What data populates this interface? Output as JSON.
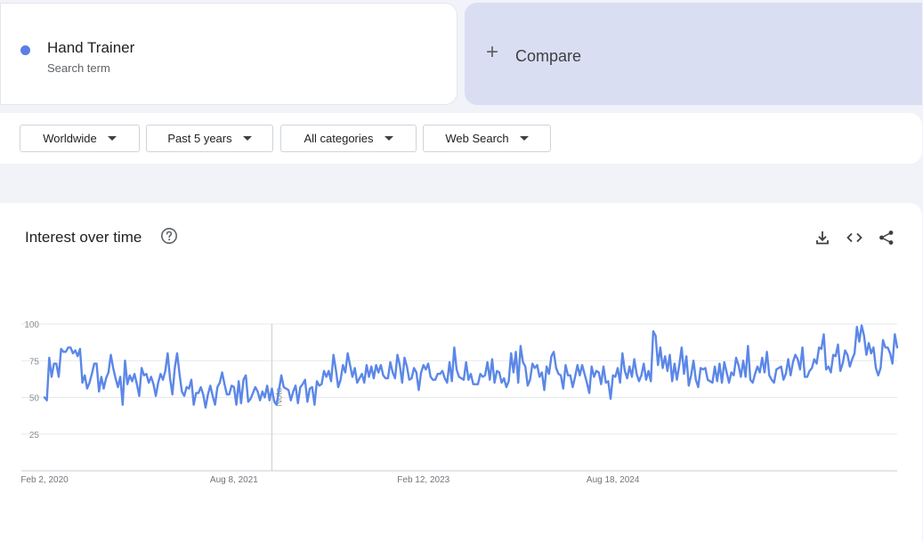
{
  "search_term": {
    "name": "Hand Trainer",
    "subtitle": "Search term",
    "color": "#5b7ee5"
  },
  "compare": {
    "label": "Compare"
  },
  "filters": [
    {
      "label": "Worldwide"
    },
    {
      "label": "Past 5 years"
    },
    {
      "label": "All categories"
    },
    {
      "label": "Web Search"
    }
  ],
  "panel": {
    "title": "Interest over time",
    "help_icon": "help-circle-icon",
    "actions": [
      "download-icon",
      "embed-code-icon",
      "share-icon"
    ]
  },
  "chart_data": {
    "type": "line",
    "ylim": [
      0,
      100
    ],
    "y_ticks": [
      100,
      75,
      50,
      25
    ],
    "x_tick_labels": [
      "Feb 2, 2020",
      "Aug 8, 2021",
      "Feb 12, 2023",
      "Aug 18, 2024"
    ],
    "x_tick_index": [
      0,
      80,
      160,
      240
    ],
    "note_label": "Note",
    "note_index": 96,
    "grid": true,
    "line_color": "#5b87e8",
    "series": [
      {
        "values": [
          50,
          48,
          77,
          64,
          73,
          73,
          64,
          83,
          81,
          81,
          84,
          84,
          80,
          82,
          78,
          83,
          60,
          65,
          56,
          60,
          66,
          73,
          73,
          54,
          64,
          56,
          63,
          67,
          79,
          70,
          63,
          57,
          64,
          45,
          75,
          59,
          65,
          61,
          66,
          59,
          51,
          70,
          65,
          66,
          60,
          64,
          59,
          51,
          60,
          66,
          62,
          68,
          80,
          63,
          52,
          70,
          80,
          66,
          54,
          51,
          57,
          56,
          62,
          45,
          53,
          53,
          57,
          52,
          43,
          52,
          58,
          51,
          45,
          57,
          60,
          67,
          59,
          52,
          52,
          58,
          57,
          45,
          61,
          46,
          62,
          65,
          47,
          49,
          53,
          57,
          54,
          48,
          54,
          50,
          58,
          48,
          56,
          47,
          45,
          55,
          65,
          57,
          56,
          55,
          48,
          54,
          58,
          46,
          57,
          59,
          62,
          47,
          56,
          57,
          45,
          61,
          58,
          59,
          68,
          64,
          68,
          61,
          79,
          69,
          57,
          62,
          72,
          67,
          80,
          72,
          64,
          70,
          60,
          63,
          66,
          60,
          72,
          64,
          71,
          63,
          72,
          67,
          72,
          65,
          63,
          63,
          74,
          67,
          63,
          79,
          72,
          60,
          77,
          71,
          62,
          63,
          70,
          67,
          55,
          67,
          72,
          69,
          73,
          64,
          62,
          62,
          66,
          66,
          68,
          63,
          60,
          74,
          61,
          84,
          69,
          64,
          63,
          62,
          74,
          62,
          66,
          59,
          59,
          59,
          66,
          64,
          65,
          74,
          62,
          76,
          60,
          68,
          67,
          60,
          63,
          57,
          61,
          80,
          67,
          81,
          60,
          85,
          74,
          71,
          58,
          62,
          73,
          70,
          72,
          64,
          67,
          55,
          71,
          66,
          78,
          81,
          70,
          66,
          65,
          56,
          72,
          65,
          65,
          57,
          64,
          72,
          65,
          72,
          66,
          60,
          53,
          71,
          64,
          68,
          67,
          59,
          71,
          60,
          61,
          49,
          65,
          64,
          70,
          60,
          80,
          68,
          63,
          71,
          64,
          76,
          66,
          61,
          65,
          73,
          62,
          68,
          61,
          95,
          92,
          72,
          84,
          70,
          78,
          68,
          79,
          61,
          73,
          62,
          72,
          84,
          66,
          78,
          58,
          65,
          75,
          62,
          57,
          70,
          69,
          70,
          62,
          61,
          60,
          71,
          61,
          73,
          60,
          74,
          67,
          60,
          67,
          65,
          77,
          72,
          64,
          75,
          64,
          85,
          62,
          60,
          66,
          71,
          67,
          77,
          67,
          81,
          65,
          62,
          60,
          69,
          70,
          71,
          62,
          66,
          76,
          65,
          74,
          79,
          76,
          69,
          84,
          64,
          64,
          68,
          70,
          76,
          73,
          84,
          83,
          93,
          69,
          71,
          67,
          79,
          78,
          86,
          68,
          73,
          82,
          79,
          71,
          76,
          80,
          98,
          88,
          99,
          92,
          79,
          87,
          80,
          84,
          70,
          65,
          70,
          89,
          84,
          84,
          80,
          73,
          93,
          84
        ]
      }
    ]
  }
}
